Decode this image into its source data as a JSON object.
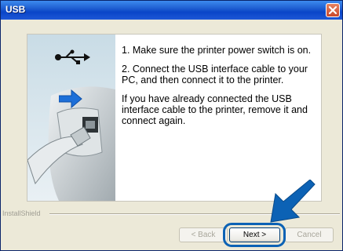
{
  "window": {
    "title": "USB"
  },
  "instructions": [
    "1. Make sure the printer power switch is on.",
    "2. Connect the USB interface cable to your PC, and then connect it to the printer.",
    "If you have already connected the USB interface cable to the printer, remove it and connect again."
  ],
  "footer": {
    "brand": "InstallShield"
  },
  "buttons": {
    "back": "< Back",
    "next": "Next >",
    "cancel": "Cancel"
  },
  "colors": {
    "title_bar": "#1f5fd1",
    "highlight": "#0c62b5",
    "close": "#c9482c"
  }
}
